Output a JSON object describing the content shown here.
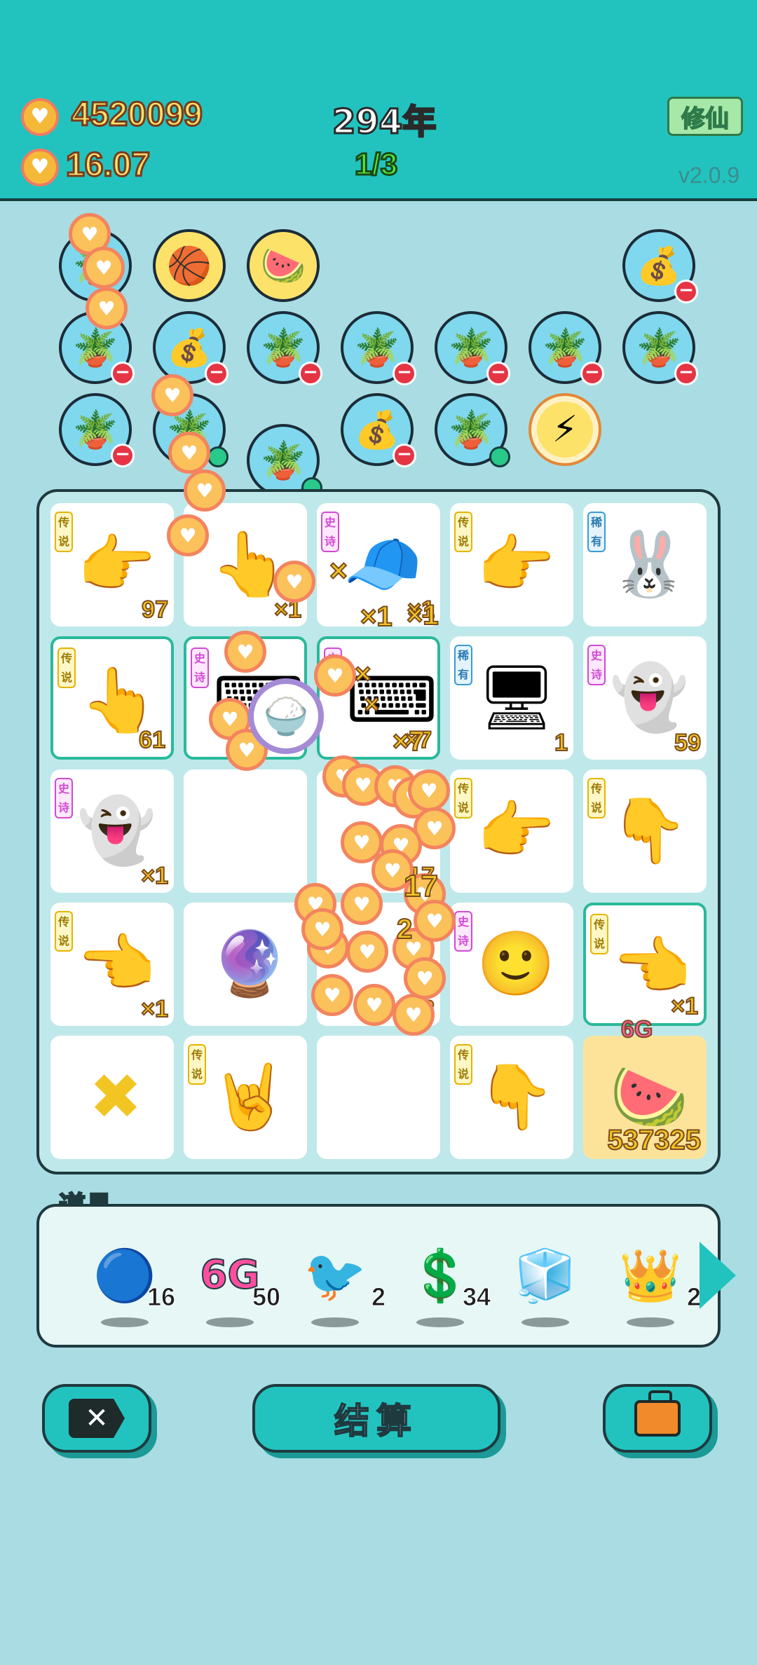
{
  "header": {
    "coins_total": "4520099",
    "coins_rate": "16.07",
    "year": "294年",
    "round": "1/3",
    "xiuxian_button": "修仙",
    "version": "v2.0.9"
  },
  "icons": {
    "coin": "♥",
    "minus": "−",
    "close_x": "✕"
  },
  "bubbles": [
    {
      "name": "bubble-potted-flower",
      "glyph": "🪴",
      "badge": "none"
    },
    {
      "name": "bubble-basketballs",
      "glyph": "🏀",
      "badge": "none"
    },
    {
      "name": "bubble-fruit-basket",
      "glyph": "🍉",
      "badge": "none"
    },
    {
      "name": "bubble-money-bag",
      "glyph": "💰",
      "badge": "minus"
    },
    {
      "name": "bubble-potted-flower",
      "glyph": "🪴",
      "badge": "minus"
    },
    {
      "name": "bubble-money-bag",
      "glyph": "💰",
      "badge": "minus"
    },
    {
      "name": "bubble-potted-flower",
      "glyph": "🪴",
      "badge": "minus"
    },
    {
      "name": "bubble-potted-flower",
      "glyph": "🪴",
      "badge": "minus"
    },
    {
      "name": "bubble-potted-flower",
      "glyph": "🪴",
      "badge": "minus"
    },
    {
      "name": "bubble-potted-flower",
      "glyph": "🪴",
      "badge": "minus"
    },
    {
      "name": "bubble-potted-flower",
      "glyph": "🪴",
      "badge": "minus"
    },
    {
      "name": "bubble-potted-flower",
      "glyph": "🪴",
      "badge": "minus"
    },
    {
      "name": "bubble-potted-flower",
      "glyph": "🪴",
      "badge": "green"
    },
    {
      "name": "bubble-potted-flower",
      "glyph": "🪴",
      "badge": "green"
    },
    {
      "name": "bubble-money-bag",
      "glyph": "💰",
      "badge": "minus"
    },
    {
      "name": "bubble-potted-flower",
      "glyph": "🪴",
      "badge": "green"
    },
    {
      "name": "bubble-energy",
      "glyph": "⚡",
      "badge": "none"
    }
  ],
  "board": {
    "cells": [
      {
        "name": "cell-pointing-hand",
        "tag": "传说",
        "rarity": "leg",
        "glyph": "👉",
        "count": "97"
      },
      {
        "name": "cell-pointing-hand",
        "tag": "",
        "rarity": "",
        "glyph": "👆",
        "count": "×1"
      },
      {
        "name": "cell-green-cap-guy",
        "tag": "史诗",
        "rarity": "epic",
        "glyph": "🧢",
        "count": "×1"
      },
      {
        "name": "cell-pointing-hand",
        "tag": "传说",
        "rarity": "leg",
        "glyph": "👉",
        "count": ""
      },
      {
        "name": "cell-rabbit",
        "tag": "稀有",
        "rarity": "rare",
        "glyph": "🐰",
        "count": ""
      },
      {
        "name": "cell-pointing-hand",
        "tag": "传说",
        "rarity": "leg",
        "glyph": "👆",
        "count": "61"
      },
      {
        "name": "cell-keyboard-key",
        "tag": "史诗",
        "rarity": "epic",
        "glyph": "⌨",
        "count": ""
      },
      {
        "name": "cell-ctrl-c-keys",
        "tag": "史诗",
        "rarity": "epic",
        "glyph": "⌨",
        "count": "×7"
      },
      {
        "name": "cell-computer-tower",
        "tag": "稀有",
        "rarity": "rare",
        "glyph": "🖥",
        "count": "1"
      },
      {
        "name": "cell-ghost",
        "tag": "史诗",
        "rarity": "epic",
        "glyph": "👻",
        "count": "59"
      },
      {
        "name": "cell-ghost",
        "tag": "史诗",
        "rarity": "epic",
        "glyph": "👻",
        "count": "×1"
      },
      {
        "name": "cell-empty",
        "tag": "",
        "rarity": "",
        "glyph": "",
        "count": ""
      },
      {
        "name": "cell-hidden",
        "tag": "",
        "rarity": "",
        "glyph": "",
        "count": "17"
      },
      {
        "name": "cell-pointing-hand",
        "tag": "传说",
        "rarity": "leg",
        "glyph": "👉",
        "count": ""
      },
      {
        "name": "cell-pointing-hand",
        "tag": "传说",
        "rarity": "leg",
        "glyph": "👇",
        "count": ""
      },
      {
        "name": "cell-pointing-hand",
        "tag": "传说",
        "rarity": "leg",
        "glyph": "👈",
        "count": "×1"
      },
      {
        "name": "cell-rabbit-globe",
        "tag": "",
        "rarity": "",
        "glyph": "🔮",
        "count": ""
      },
      {
        "name": "cell-hidden",
        "tag": "",
        "rarity": "",
        "glyph": "",
        "count": "2"
      },
      {
        "name": "cell-yellow-face",
        "tag": "史诗",
        "rarity": "epic",
        "glyph": "🙂",
        "count": ""
      },
      {
        "name": "cell-pointing-hand",
        "tag": "传说",
        "rarity": "leg",
        "glyph": "👈",
        "count": "×1"
      },
      {
        "name": "cell-cross-mark",
        "tag": "",
        "rarity": "",
        "glyph": "✖",
        "count": ""
      },
      {
        "name": "cell-pointing-hand",
        "tag": "传说",
        "rarity": "leg",
        "glyph": "🤘",
        "count": ""
      },
      {
        "name": "cell-empty",
        "tag": "",
        "rarity": "",
        "glyph": "",
        "count": ""
      },
      {
        "name": "cell-pointing-hand",
        "tag": "传说",
        "rarity": "leg",
        "glyph": "👇",
        "count": ""
      },
      {
        "name": "cell-watermelon-phone",
        "tag": "",
        "rarity": "",
        "glyph": "🍉",
        "count": "537325"
      }
    ],
    "phone_label": "6G"
  },
  "props": {
    "label": "道具",
    "items": [
      {
        "name": "prop-blue-orb",
        "glyph": "🔵",
        "count": "16"
      },
      {
        "name": "prop-6g",
        "glyph": "6G",
        "count": "50"
      },
      {
        "name": "prop-duck",
        "glyph": "🐦",
        "count": "2"
      },
      {
        "name": "prop-dollar-coin",
        "glyph": "💲",
        "count": "34"
      },
      {
        "name": "prop-fridge-frame",
        "glyph": "🧊",
        "count": ""
      },
      {
        "name": "prop-crown",
        "glyph": "👑",
        "count": "2"
      }
    ]
  },
  "buttons": {
    "settle": "结算"
  },
  "overlay": {
    "multipliers": [
      "×",
      "×1",
      "×1",
      "×",
      "×7",
      "×",
      "17",
      "2"
    ]
  }
}
